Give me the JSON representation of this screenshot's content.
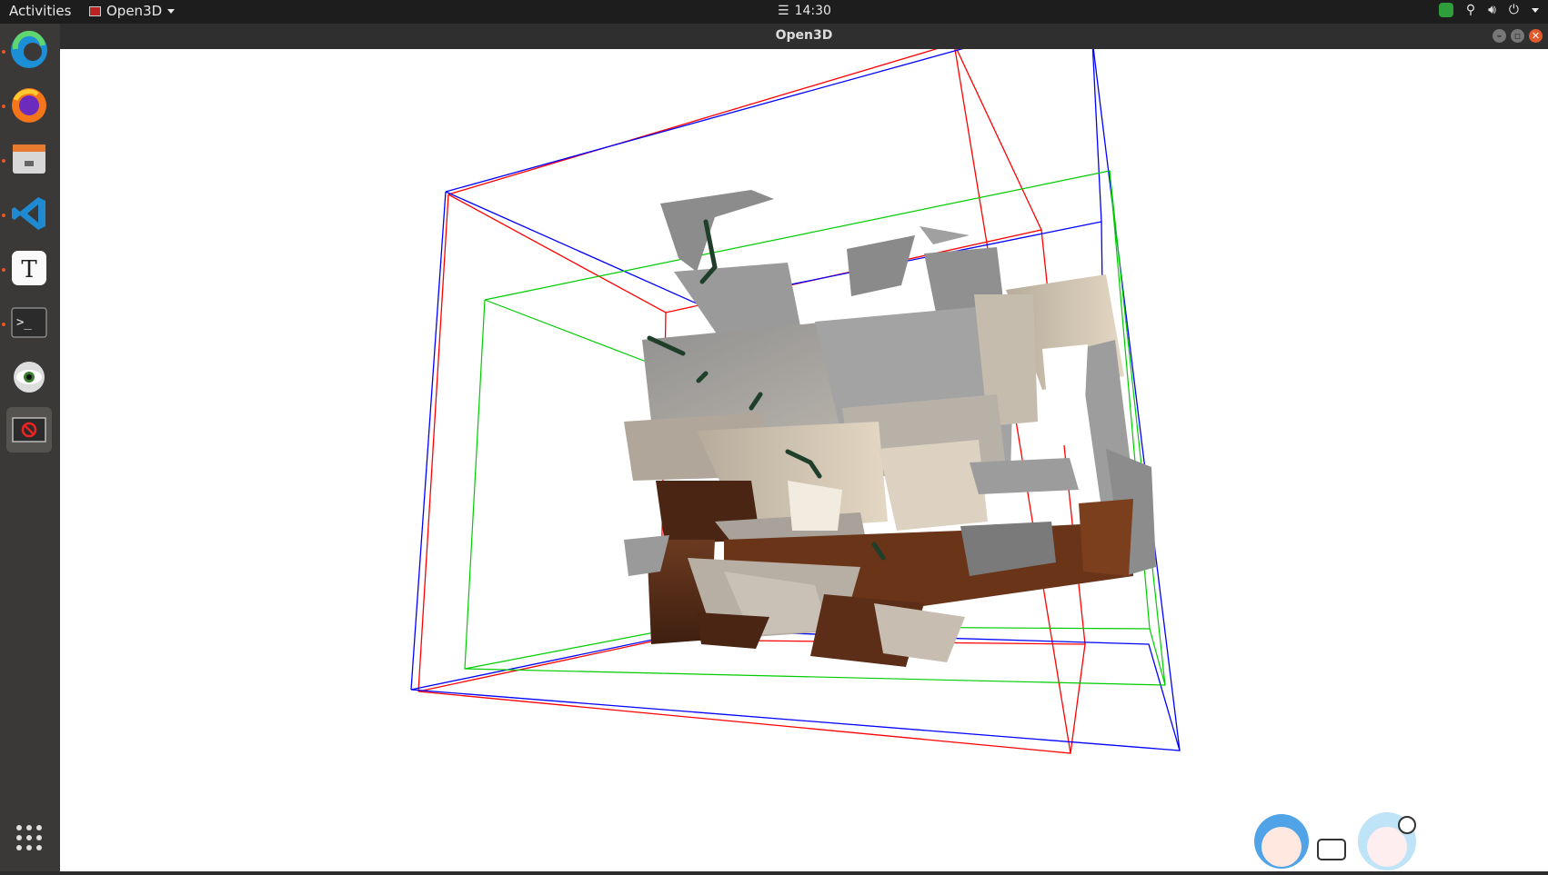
{
  "topbar": {
    "activities": "Activities",
    "app_name": "Open3D",
    "clock": "14:30"
  },
  "window": {
    "title": "Open3D"
  },
  "dock": {
    "items": [
      "edge-browser",
      "firefox",
      "file-manager",
      "vscode",
      "text-editor",
      "terminal",
      "eye-of-gnome",
      "open3d-app"
    ],
    "running": [
      "edge-browser",
      "firefox",
      "file-manager",
      "vscode",
      "text-editor",
      "terminal"
    ]
  },
  "colors": {
    "bbox_red": "#ff0000",
    "bbox_blue": "#0000ff",
    "bbox_green": "#00dd00",
    "wood": "#5c2e17",
    "surface_gray": "#a8a8a8",
    "accent": "#e95420"
  }
}
